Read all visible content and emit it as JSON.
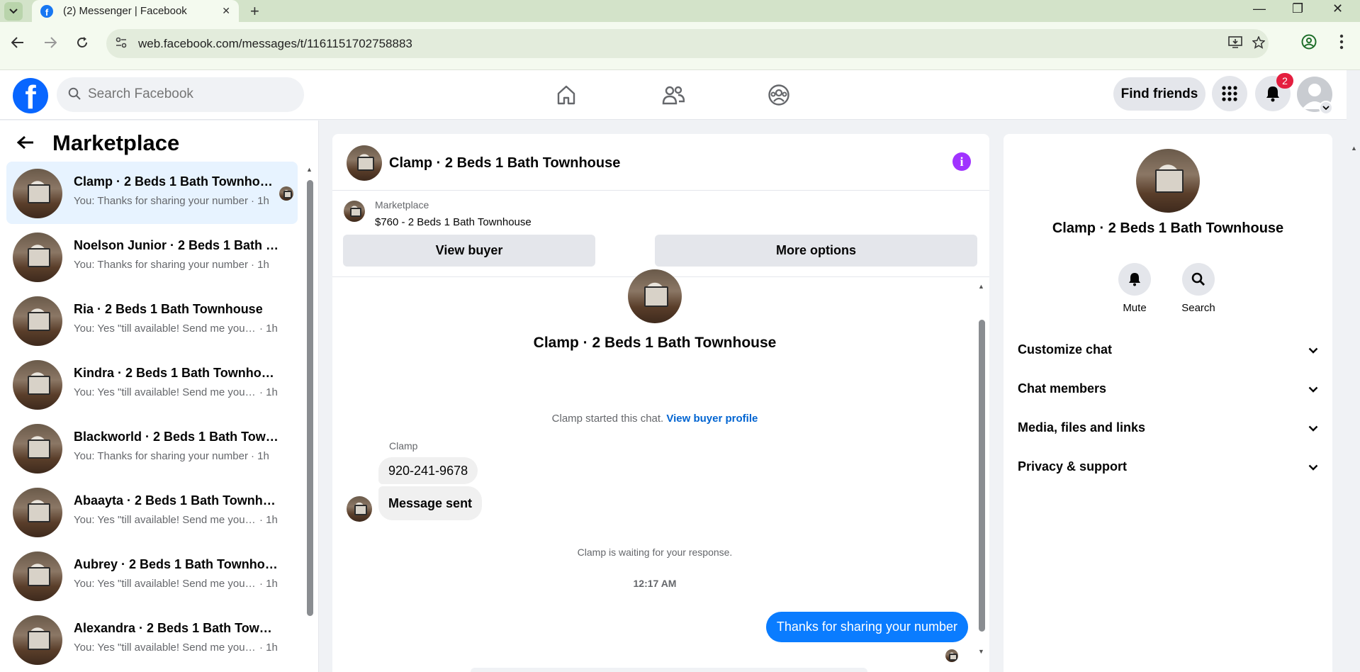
{
  "browser": {
    "tab_title": "(2) Messenger | Facebook",
    "tab_close": "✕",
    "new_tab": "+",
    "url": "web.facebook.com/messages/t/1161151702758883",
    "window_controls": [
      "—",
      "❐",
      "✕"
    ]
  },
  "fb_header": {
    "logo": "f",
    "search_placeholder": "Search Facebook",
    "find_friends": "Find friends",
    "notification_count": "2"
  },
  "sidebar": {
    "title": "Marketplace",
    "conversations": [
      {
        "name": "Clamp · 2 Beds 1 Bath Townhouse",
        "preview": "You: Thanks for sharing your number",
        "time": "· 1h",
        "active": true
      },
      {
        "name": "Noelson Junior · 2 Beds 1 Bath Townhouse",
        "preview": "You: Thanks for sharing your number",
        "time": "· 1h"
      },
      {
        "name": "Ria · 2 Beds 1 Bath Townhouse",
        "preview": "You: Yes \"till available! Send me your number",
        "time": "· 1h"
      },
      {
        "name": "Kindra · 2 Beds 1 Bath Townhouse",
        "preview": "You: Yes \"till available! Send me your number",
        "time": "· 1h"
      },
      {
        "name": "Blackworld · 2 Beds 1 Bath Townhouse",
        "preview": "You: Thanks for sharing your number",
        "time": "· 1h"
      },
      {
        "name": "Abaayta · 2 Beds 1 Bath Townhouse",
        "preview": "You: Yes \"till available! Send me your number",
        "time": "· 1h"
      },
      {
        "name": "Aubrey · 2 Beds 1 Bath Townhouse",
        "preview": "You: Yes \"till available! Send me your number",
        "time": "· 1h"
      },
      {
        "name": "Alexandra · 2 Beds 1 Bath Townhouse",
        "preview": "You: Yes \"till available! Send me your number",
        "time": "· 1h"
      }
    ]
  },
  "chat": {
    "title": "Clamp · 2 Beds 1 Bath Townhouse",
    "marketplace_label": "Marketplace",
    "listing": "$760 - 2 Beds 1 Bath Townhouse",
    "view_buyer": "View buyer",
    "more_options": "More options",
    "intro_name": "Clamp · 2 Beds 1 Bath Townhouse",
    "started_text": "Clamp started this chat.",
    "view_buyer_profile": "View buyer profile",
    "sender": "Clamp",
    "messages_in": [
      "920-241-9678",
      "Message sent"
    ],
    "waiting_text": "Clamp is waiting for your response.",
    "timestamp": "12:17 AM",
    "message_out": "Thanks for sharing your number"
  },
  "info_panel": {
    "name": "Clamp · 2 Beds 1 Bath Townhouse",
    "actions": [
      "Mute",
      "Search"
    ],
    "sections": [
      "Customize chat",
      "Chat members",
      "Media, files and links",
      "Privacy & support"
    ]
  },
  "colors": {
    "brand_blue": "#0866ff",
    "bubble_out": "#0a7cff",
    "info_purple": "#a033ff",
    "badge_red": "#e41e3f",
    "active_row": "#e7f3ff"
  },
  "icons": [
    "tab-list-icon",
    "facebook-favicon",
    "back-icon",
    "forward-icon",
    "reload-icon",
    "site-info-icon",
    "install-icon",
    "star-icon",
    "account-icon",
    "kebab-menu-icon",
    "search-icon",
    "home-icon",
    "friends-icon",
    "groups-icon",
    "grid-menu-icon",
    "bell-icon",
    "arrow-left-icon",
    "info-icon",
    "chevron-down-icon"
  ]
}
